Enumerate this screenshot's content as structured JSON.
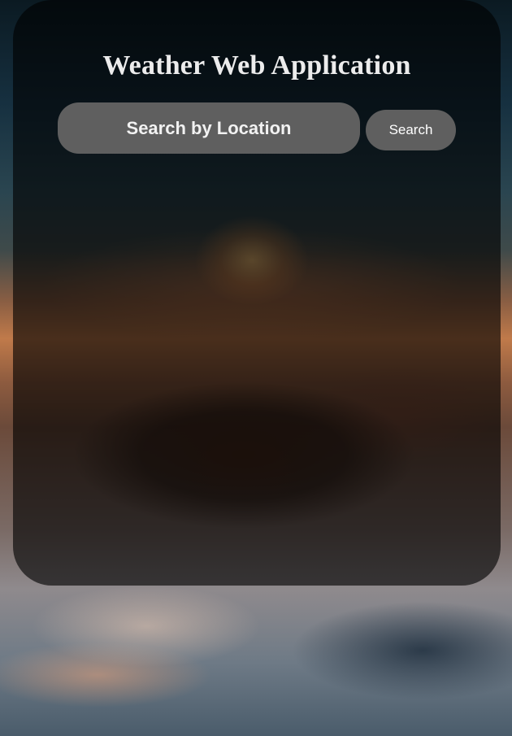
{
  "app": {
    "title": "Weather Web Application"
  },
  "search": {
    "placeholder": "Search by Location",
    "value": "",
    "button_label": "Search"
  }
}
